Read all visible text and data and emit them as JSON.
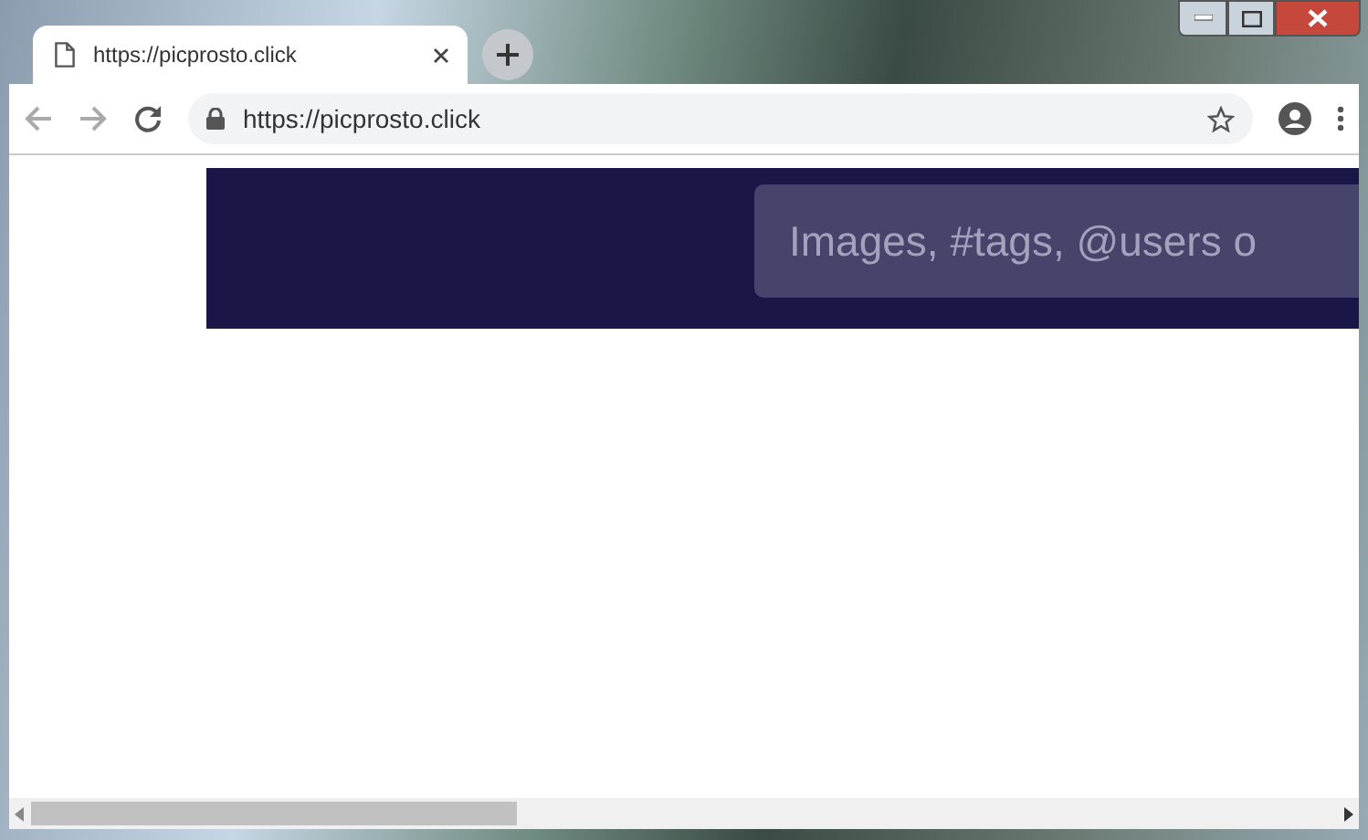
{
  "tabs": [
    {
      "title": "https://picprosto.click",
      "selected": true
    }
  ],
  "address_bar": {
    "url": "https://picprosto.click"
  },
  "page": {
    "search": {
      "placeholder": "Images, #tags, @users o"
    }
  }
}
